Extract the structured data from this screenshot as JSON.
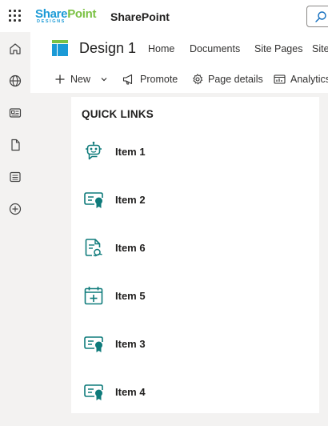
{
  "suite_bar": {
    "brand": {
      "share": "Share",
      "point": "Point",
      "tagline": "DESIGNS"
    },
    "app_name": "SharePoint"
  },
  "site": {
    "title": "Design 1",
    "nav": [
      "Home",
      "Documents",
      "Site Pages",
      "Site"
    ]
  },
  "command_bar": {
    "new_label": "New",
    "promote_label": "Promote",
    "page_details_label": "Page details",
    "analytics_label": "Analytics"
  },
  "quick_links": {
    "title": "QUICK LINKS",
    "accent_color": "#0f7b7b",
    "items": [
      {
        "label": "Item 1",
        "icon": "bot-icon"
      },
      {
        "label": "Item 2",
        "icon": "certificate-icon"
      },
      {
        "label": "Item 6",
        "icon": "document-signature-icon"
      },
      {
        "label": "Item 5",
        "icon": "calendar-add-icon"
      },
      {
        "label": "Item 3",
        "icon": "certificate-icon"
      },
      {
        "label": "Item 4",
        "icon": "certificate-icon"
      }
    ]
  }
}
